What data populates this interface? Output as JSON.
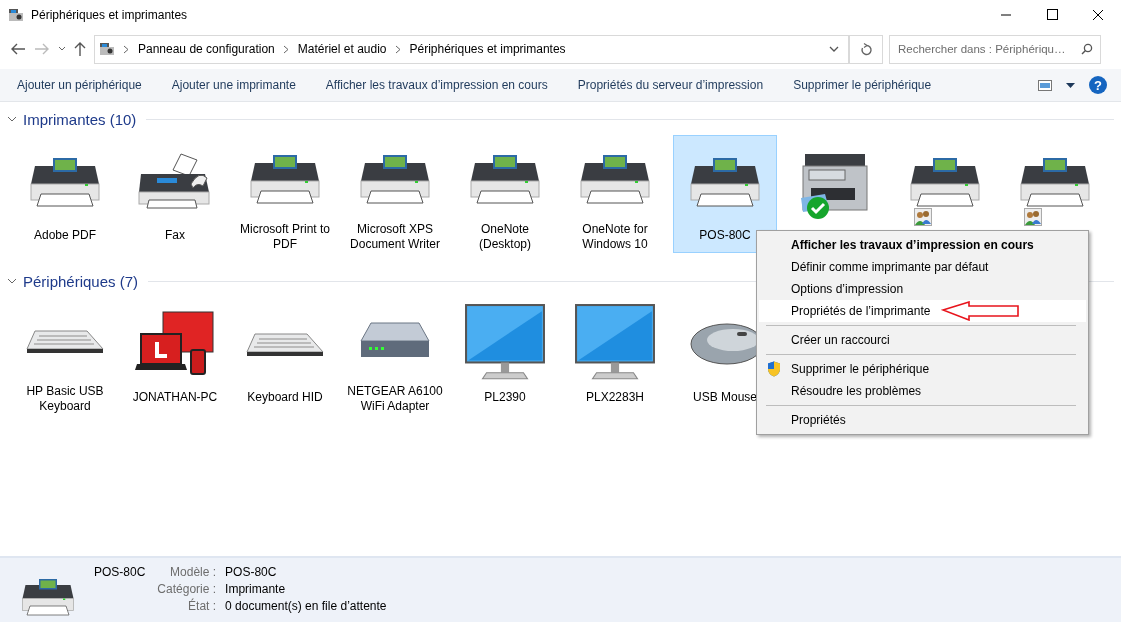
{
  "window": {
    "title": "Périphériques et imprimantes"
  },
  "address": {
    "path": [
      "Panneau de configuration",
      "Matériel et audio",
      "Périphériques et imprimantes"
    ]
  },
  "search": {
    "placeholder": "Rechercher dans : Périphériqu…"
  },
  "help": {
    "label": "?"
  },
  "commands": [
    "Ajouter un périphérique",
    "Ajouter une imprimante",
    "Afficher les travaux d’impression en cours",
    "Propriétés du serveur d’impression",
    "Supprimer le périphérique"
  ],
  "sections": [
    {
      "title": "Imprimantes (10)",
      "expanded": true,
      "items": [
        {
          "label": "Adobe PDF",
          "kind": "printer",
          "selected": false,
          "default": false,
          "shared": false
        },
        {
          "label": "Fax",
          "kind": "fax",
          "selected": false,
          "default": false,
          "shared": false
        },
        {
          "label": "Microsoft Print to PDF",
          "kind": "printer",
          "selected": false,
          "default": false,
          "shared": false
        },
        {
          "label": "Microsoft XPS Document Writer",
          "kind": "printer",
          "selected": false,
          "default": false,
          "shared": false
        },
        {
          "label": "OneNote (Desktop)",
          "kind": "printer",
          "selected": false,
          "default": false,
          "shared": false
        },
        {
          "label": "OneNote for Windows 10",
          "kind": "printer",
          "selected": false,
          "default": false,
          "shared": false
        },
        {
          "label": "POS-80C",
          "kind": "printer",
          "selected": true,
          "default": false,
          "shared": false
        },
        {
          "kind": "mfp",
          "selected": false,
          "default": true,
          "shared": false
        },
        {
          "kind": "printer",
          "selected": false,
          "default": false,
          "shared": true
        },
        {
          "kind": "printer",
          "selected": false,
          "default": false,
          "shared": true
        }
      ]
    },
    {
      "title": "Périphériques (7)",
      "expanded": true,
      "items": [
        {
          "label": "HP Basic USB Keyboard",
          "kind": "keyboard",
          "selected": false
        },
        {
          "label": "JONATHAN-PC",
          "kind": "computer",
          "selected": false
        },
        {
          "label": "Keyboard HID",
          "kind": "keyboard",
          "selected": false
        },
        {
          "label": "NETGEAR A6100 WiFi Adapter",
          "kind": "router",
          "selected": false
        },
        {
          "label": "PL2390",
          "kind": "monitor",
          "selected": false
        },
        {
          "label": "PLX2283H",
          "kind": "monitor",
          "selected": false
        },
        {
          "label": "USB Mouse",
          "kind": "mouse",
          "selected": false
        }
      ]
    }
  ],
  "context_menu": {
    "items": [
      {
        "kind": "item",
        "label": "Afficher les travaux d’impression en cours",
        "bold": true,
        "selected": false,
        "shield": false,
        "annotated": false
      },
      {
        "kind": "item",
        "label": "Définir comme imprimante par défaut",
        "bold": false,
        "selected": false,
        "shield": false,
        "annotated": false
      },
      {
        "kind": "item",
        "label": "Options d’impression",
        "bold": false,
        "selected": false,
        "shield": false,
        "annotated": false
      },
      {
        "kind": "item",
        "label": "Propriétés de l’imprimante",
        "bold": false,
        "selected": true,
        "shield": false,
        "annotated": true
      },
      {
        "kind": "separator"
      },
      {
        "kind": "item",
        "label": "Créer un raccourci",
        "bold": false,
        "selected": false,
        "shield": false,
        "annotated": false
      },
      {
        "kind": "separator"
      },
      {
        "kind": "item",
        "label": "Supprimer le périphérique",
        "bold": false,
        "selected": false,
        "shield": true,
        "annotated": false
      },
      {
        "kind": "item",
        "label": "Résoudre les problèmes",
        "bold": false,
        "selected": false,
        "shield": false,
        "annotated": false
      },
      {
        "kind": "separator"
      },
      {
        "kind": "item",
        "label": "Propriétés",
        "bold": false,
        "selected": false,
        "shield": false,
        "annotated": false
      }
    ]
  },
  "details": {
    "name": "POS-80C",
    "fields": [
      {
        "label": "Modèle :",
        "value": "POS-80C"
      },
      {
        "label": "Catégorie :",
        "value": "Imprimante"
      },
      {
        "label": "État :",
        "value": "0 document(s) en file d’attente"
      }
    ]
  }
}
